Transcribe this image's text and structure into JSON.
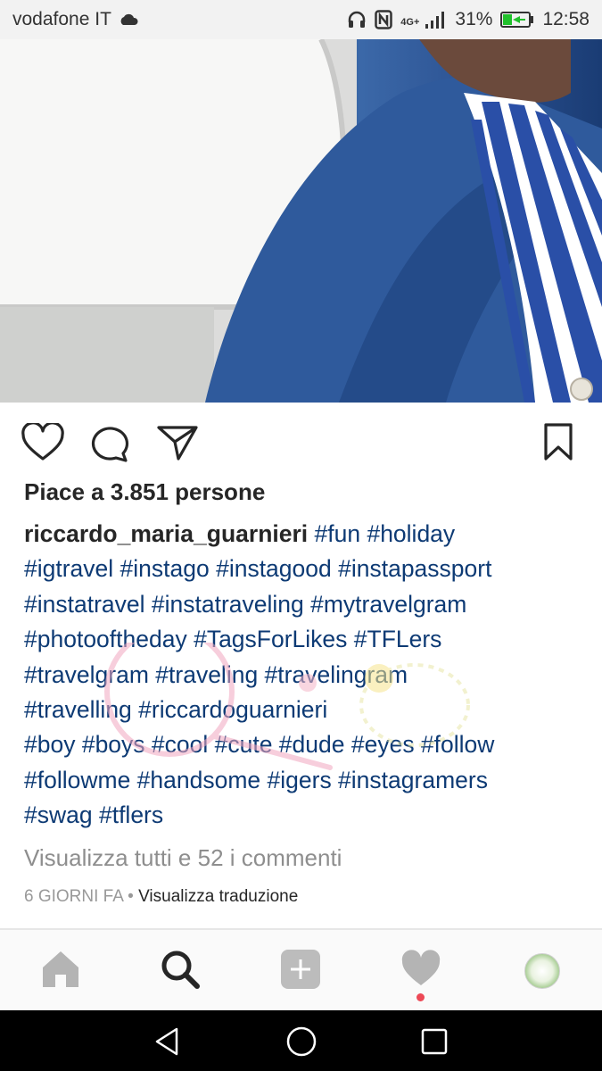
{
  "status_bar": {
    "carrier": "vodafone IT",
    "battery": "31%",
    "time": "12:58",
    "network": "4G+"
  },
  "post": {
    "likes_text": "Piace a 3.851 persone",
    "username": "riccardo_maria_guarnieri",
    "caption_lines": [
      " #fun #holiday",
      "#igtravel #instago #instagood #instapassport",
      "#instatravel #instatraveling #mytravelgram",
      "#photooftheday #TagsForLikes #TFLers",
      "#travelgram #traveling #travelingram",
      "#travelling #riccardoguarnieri",
      "#boy #boys #cool #cute #dude #eyes #follow",
      "#followme #handsome #igers #instagramers",
      "#swag #tflers"
    ],
    "view_comments": "Visualizza tutti e 52 i commenti",
    "time_ago": "6 GIORNI FA",
    "separator": " • ",
    "translate": "Visualizza traduzione"
  },
  "icons": {
    "like": "heart-outline-icon",
    "comment": "comment-bubble-icon",
    "share": "paper-plane-icon",
    "save": "bookmark-icon",
    "home": "home-icon",
    "search": "search-icon",
    "add": "add-post-icon",
    "activity": "heart-icon",
    "profile": "avatar-icon"
  },
  "colors": {
    "hashtag": "#0d3a74",
    "notification_dot": "#ed4956"
  }
}
